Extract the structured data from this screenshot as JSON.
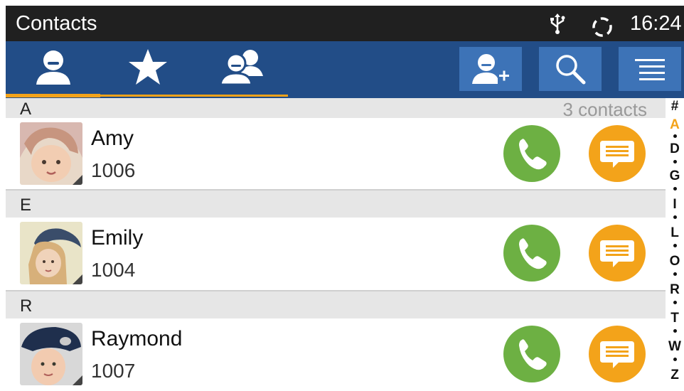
{
  "status_bar": {
    "title": "Contacts",
    "time": "16:24",
    "icons": [
      "usb-icon",
      "sync-icon"
    ]
  },
  "tabs": [
    {
      "name": "contacts",
      "icon": "person-icon",
      "selected": true
    },
    {
      "name": "favorites",
      "icon": "star-icon",
      "selected": false
    },
    {
      "name": "groups",
      "icon": "group-icon",
      "selected": false
    }
  ],
  "toolbar": {
    "actions": [
      "add-contact-icon",
      "search-icon",
      "menu-icon"
    ]
  },
  "list": {
    "count_label": "3 contacts",
    "sections": [
      {
        "letter": "A",
        "contacts": [
          {
            "name": "Amy",
            "number": "1006"
          }
        ]
      },
      {
        "letter": "E",
        "contacts": [
          {
            "name": "Emily",
            "number": "1004"
          }
        ]
      },
      {
        "letter": "R",
        "contacts": [
          {
            "name": "Raymond",
            "number": "1007"
          }
        ]
      }
    ]
  },
  "alpha_index": {
    "letters": [
      "#",
      "A",
      "D",
      "G",
      "I",
      "L",
      "O",
      "R",
      "T",
      "W",
      "Z"
    ],
    "active": "A"
  },
  "colors": {
    "status_bar": "#202020",
    "tab_bar": "#224d87",
    "tab_button": "#3d73b7",
    "accent": "#f3a31a",
    "call": "#6db043",
    "message": "#f3a31a",
    "section": "#e6e6e6"
  }
}
